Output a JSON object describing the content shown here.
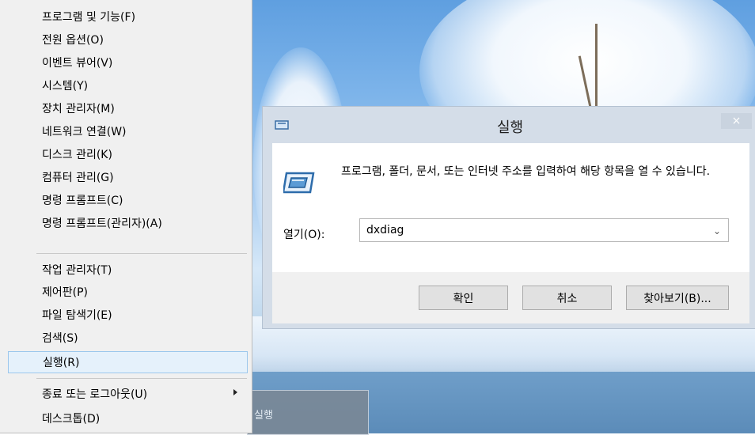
{
  "context_menu": {
    "items": [
      {
        "label": "프로그램 및 기능(F)"
      },
      {
        "label": "전원 옵션(O)"
      },
      {
        "label": "이벤트 뷰어(V)"
      },
      {
        "label": "시스템(Y)"
      },
      {
        "label": "장치 관리자(M)"
      },
      {
        "label": "네트워크 연결(W)"
      },
      {
        "label": "디스크 관리(K)"
      },
      {
        "label": "컴퓨터 관리(G)"
      },
      {
        "label": "명령 프롬프트(C)"
      },
      {
        "label": "명령 프롬프트(관리자)(A)"
      },
      {
        "label": "작업 관리자(T)"
      },
      {
        "label": "제어판(P)"
      },
      {
        "label": "파일 탐색기(E)"
      },
      {
        "label": "검색(S)"
      },
      {
        "label": "실행(R)",
        "selected": true
      },
      {
        "label": "종료 또는 로그아웃(U)",
        "has_submenu": true
      },
      {
        "label": "데스크톱(D)"
      }
    ]
  },
  "run_dialog": {
    "title": "실행",
    "close_glyph": "×",
    "description": "프로그램, 폴더, 문서, 또는 인터넷 주소를 입력하여 해당 항목을 열 수 있습니다.",
    "open_label": "열기(O):",
    "open_value": "dxdiag",
    "ok_label": "확인",
    "cancel_label": "취소",
    "browse_label": "찾아보기(B)..."
  },
  "taskbar_preview": {
    "label": "실행"
  },
  "icons": {
    "run": "run-icon",
    "submenu": "chevron-right-icon",
    "dropdown": "chevron-down-icon",
    "close": "close-icon"
  }
}
